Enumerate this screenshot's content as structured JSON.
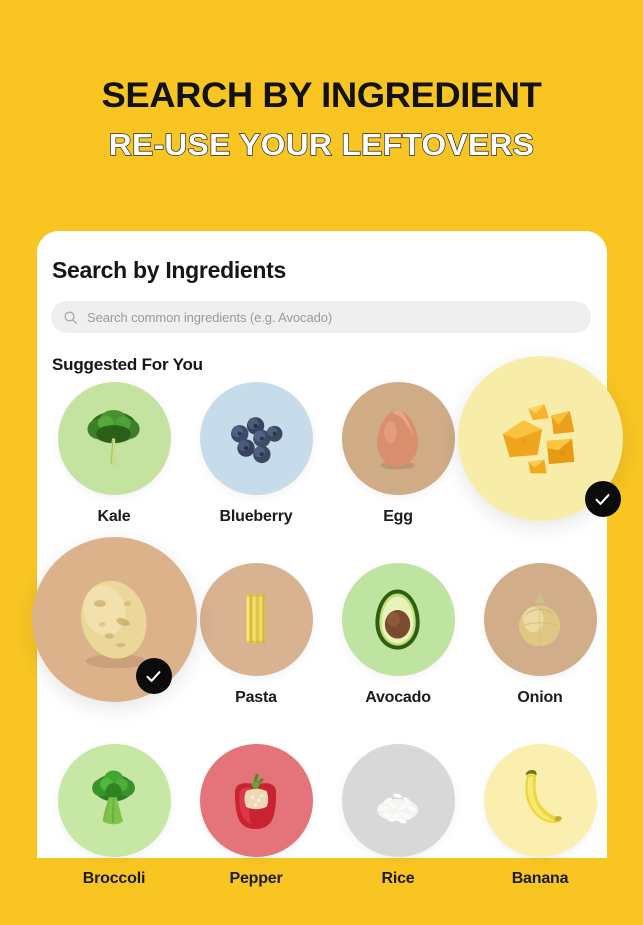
{
  "hero": {
    "line1": "SEARCH BY INGREDIENT",
    "line2": "RE-USE YOUR LEFTOVERS",
    "background_color": "#F9C523",
    "line1_color": "#121212",
    "line2_color": "#FFFFFF"
  },
  "card": {
    "title": "Search by Ingredients",
    "background_color": "#FFFFFF"
  },
  "search": {
    "placeholder": "Search common ingredients (e.g. Avocado)",
    "value": "",
    "icon": "search-icon",
    "field_color": "#EFEFEF"
  },
  "suggested": {
    "title": "Suggested For You",
    "rows": [
      [
        {
          "label": "Kale",
          "icon": "kale-icon",
          "circle_color": "#C4E3A1",
          "selected": false
        },
        {
          "label": "Blueberry",
          "icon": "blueberry-icon",
          "circle_color": "#C6DCEA",
          "selected": false
        },
        {
          "label": "Egg",
          "icon": "egg-icon",
          "circle_color": "#CFAB86",
          "selected": false
        },
        {
          "label": "Cheese",
          "icon": "cheese-icon",
          "circle_color": "#F7EDA9",
          "selected": true
        }
      ],
      [
        {
          "label": "Potato",
          "icon": "potato-icon",
          "circle_color": "#DCB28B",
          "selected": true
        },
        {
          "label": "Pasta",
          "icon": "pasta-icon",
          "circle_color": "#D8B291",
          "selected": false
        },
        {
          "label": "Avocado",
          "icon": "avocado-icon",
          "circle_color": "#BFE3A0",
          "selected": false
        },
        {
          "label": "Onion",
          "icon": "onion-icon",
          "circle_color": "#D2AD89",
          "selected": false
        }
      ],
      [
        {
          "label": "Broccoli",
          "icon": "broccoli-icon",
          "circle_color": "#C7E7A4",
          "selected": false
        },
        {
          "label": "Pepper",
          "icon": "red-pepper-icon",
          "circle_color": "#E4737A",
          "selected": false
        },
        {
          "label": "Rice",
          "icon": "rice-icon",
          "circle_color": "#D8D8D8",
          "selected": false
        },
        {
          "label": "Banana",
          "icon": "banana-icon",
          "circle_color": "#FAEFAE",
          "selected": false
        }
      ]
    ],
    "selected_badge_color": "#0B0B0B",
    "selected_check_glyph": "check-icon"
  }
}
